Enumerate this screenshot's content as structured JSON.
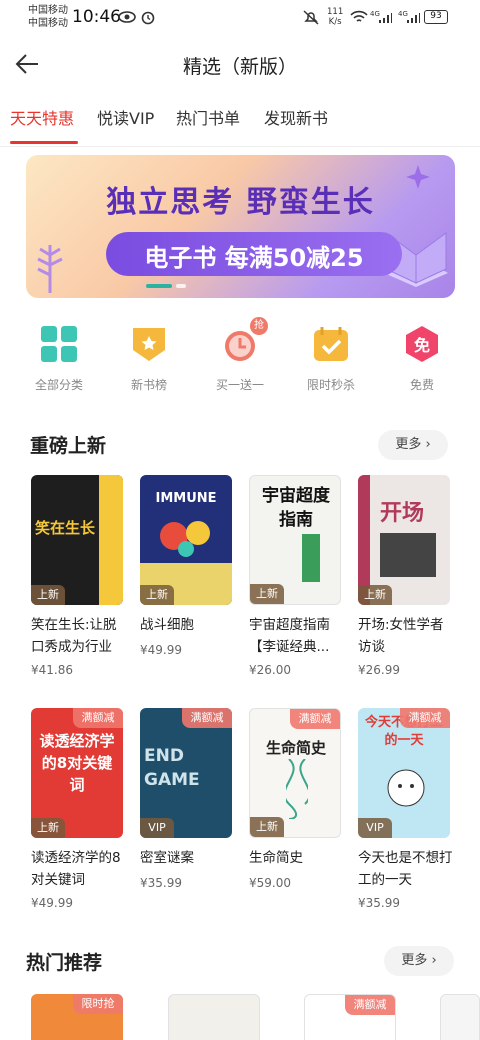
{
  "status_bar": {
    "carrier1": "中国移动",
    "carrier2": "中国移动",
    "time": "10:46",
    "speed_value": "111",
    "speed_unit": "K/s",
    "network1": "4G",
    "network2": "4G",
    "battery": "93"
  },
  "header": {
    "back_icon": "arrow-left-icon",
    "title": "精选（新版）"
  },
  "tabs": [
    {
      "label": "天天特惠",
      "active": true
    },
    {
      "label": "悦读VIP",
      "active": false
    },
    {
      "label": "热门书单",
      "active": false
    },
    {
      "label": "发现新书",
      "active": false
    }
  ],
  "banner": {
    "headline": "独立思考 野蛮生长",
    "subline": "电子书 每满50减25"
  },
  "quick_links": [
    {
      "label": "全部分类",
      "icon": "grid-icon",
      "color": "#3ec6b5"
    },
    {
      "label": "新书榜",
      "icon": "ribbon-icon",
      "color": "#f5b83d"
    },
    {
      "label": "买一送一",
      "icon": "alarm-clock-icon",
      "color": "#f07a6a",
      "tag": "抢"
    },
    {
      "label": "限时秒杀",
      "icon": "calendar-check-icon",
      "color": "#f5b83d"
    },
    {
      "label": "免费",
      "icon": "hexagon-free-icon",
      "color": "#f0446b",
      "glyph": "免"
    }
  ],
  "section1": {
    "title": "重磅上新",
    "more_label": "更多",
    "books": [
      {
        "title": "笑在生长:让脱口秀成为行业",
        "price": "¥41.86",
        "badge": "上新",
        "cover_text": "笑在生长"
      },
      {
        "title": "战斗细胞",
        "price": "¥49.99",
        "badge": "上新",
        "cover_text": "IMMUNE"
      },
      {
        "title": "宇宙超度指南【李诞经典...",
        "price": "¥26.00",
        "badge": "上新",
        "cover_text": "宇宙超度指南"
      },
      {
        "title": "开场:女性学者访谈",
        "price": "¥26.99",
        "badge": "上新",
        "cover_text": "开场"
      }
    ]
  },
  "section1b": {
    "books": [
      {
        "title": "读透经济学的8对关键词",
        "price": "¥49.99",
        "badge": "上新",
        "corner": "满额减",
        "cover_text": "读透经济学的8对关键词"
      },
      {
        "title": "密室谜案",
        "price": "¥35.99",
        "badge": "VIP",
        "corner": "满额减",
        "cover_text": "END GAME"
      },
      {
        "title": "生命简史",
        "price": "¥59.00",
        "badge": "上新",
        "corner": "满额减",
        "cover_text": "生命简史"
      },
      {
        "title": "今天也是不想打工的一天",
        "price": "¥35.99",
        "badge": "VIP",
        "corner": "满额减",
        "cover_text": "今天不想打工的一天"
      }
    ]
  },
  "section2": {
    "title": "热门推荐",
    "more_label": "更多",
    "corner_tags": [
      "限时抢",
      "满额减"
    ]
  }
}
